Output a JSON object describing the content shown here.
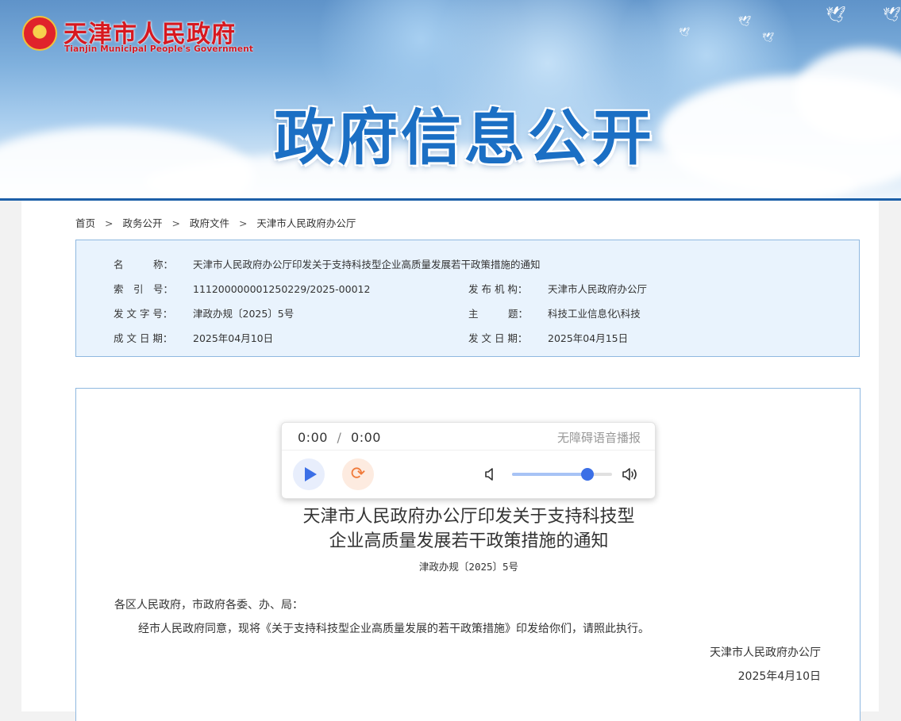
{
  "site": {
    "name_cn": "天津市人民政府",
    "name_en": "Tianjin Municipal People's Government",
    "banner_title": "政府信息公开"
  },
  "breadcrumb": {
    "items": [
      "首页",
      "政务公开",
      "政府文件",
      "天津市人民政府办公厅"
    ],
    "separator": ">"
  },
  "meta": {
    "name_label": "名　　　称：",
    "name_value": "天津市人民政府办公厅印发关于支持科技型企业高质量发展若干政策措施的通知",
    "index_label": "索　引　号：",
    "index_value": "111200000001250229/2025-00012",
    "issuer_label": "发 布 机 构：",
    "issuer_value": "天津市人民政府办公厅",
    "docno_label": "发 文 字 号：",
    "docno_value": "津政办规〔2025〕5号",
    "topic_label": "主　　　题：",
    "topic_value": "科技工业信息化\\科技",
    "written_label": "成 文 日 期：",
    "written_value": "2025年04月10日",
    "published_label": "发 文 日 期：",
    "published_value": "2025年04月15日"
  },
  "player": {
    "current_time": "0:00",
    "separator": "/",
    "duration": "0:00",
    "tts_label": "无障碍语音播报",
    "volume_level": 0.75,
    "icons": {
      "play": "play-icon",
      "loop": "loop-icon",
      "volume_low": "volume-low-icon",
      "volume_high": "volume-high-icon"
    }
  },
  "document": {
    "title_line1": "天津市人民政府办公厅印发关于支持科技型",
    "title_line2": "企业高质量发展若干政策措施的通知",
    "number": "津政办规〔2025〕5号",
    "salutation": "各区人民政府，市政府各委、办、局：",
    "body": "经市人民政府同意，现将《关于支持科技型企业高质量发展的若干政策措施》印发给你们，请照此执行。",
    "signer": "天津市人民政府办公厅",
    "date": "2025年4月10日"
  },
  "colors": {
    "brand_red": "#d7181f",
    "title_blue": "#1b6fc4",
    "meta_bg": "#e9f3fd",
    "border_blue": "#8fb8e0",
    "accent_blue": "#3b6fe6",
    "loop_orange": "#f07a3a"
  }
}
